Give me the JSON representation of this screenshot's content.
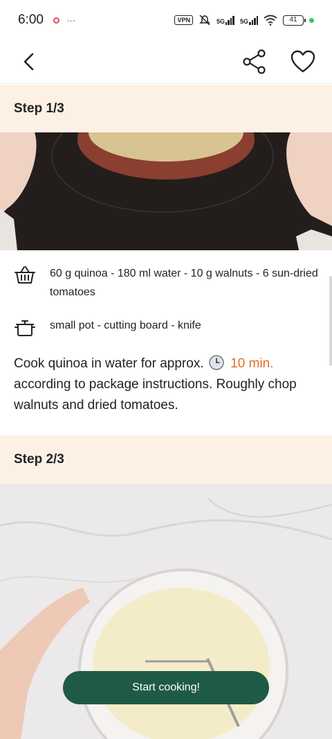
{
  "status_bar": {
    "time": "6:00",
    "more": "···",
    "vpn": "VPN",
    "network_1": "5G",
    "network_2": "5G",
    "battery": "41"
  },
  "nav": {
    "back_icon": "chevron-left-icon",
    "share_icon": "share-icon",
    "favorite_icon": "heart-icon"
  },
  "steps": [
    {
      "title": "Step 1/3",
      "ingredients": "60 g quinoa - 180 ml water - 10 g walnuts - 6 sun-dried tomatoes",
      "tools": "small pot - cutting board - knife",
      "instruction_before": "Cook quinoa in water for approx.",
      "timer": "10 min.",
      "instruction_after": "according to package instructions. Roughly chop walnuts and dried tomatoes."
    },
    {
      "title": "Step 2/3"
    }
  ],
  "cta": {
    "label": "Start cooking!"
  },
  "colors": {
    "step_header_bg": "#fdf1e6",
    "accent_orange": "#e07128",
    "button_green": "#1e5a46"
  }
}
